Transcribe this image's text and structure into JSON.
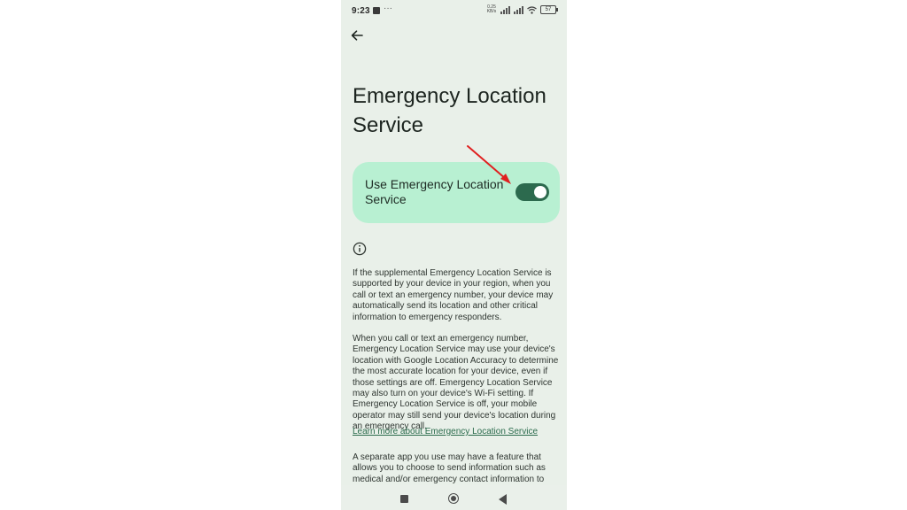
{
  "status_bar": {
    "time": "9:23",
    "net_speed": "0.25 KB/s",
    "battery": "57"
  },
  "page": {
    "title": "Emergency Location Service",
    "toggle_label": "Use Emergency Location Service",
    "toggle_on": true,
    "paragraph_1": "If the supplemental Emergency Location Service is supported by your device in your region, when you call or text an emergency number, your device may automatically send its location and other critical information to emergency responders.",
    "paragraph_2": "When you call or text an emergency number, Emergency Location Service may use your device's location with Google Location Accuracy to determine the most accurate location for your device, even if those settings are off. Emergency Location Service may also turn on your device's Wi-Fi setting. If Emergency Location Service is off, your mobile operator may still send your device's location during an emergency call.",
    "learn_more": "Learn more about Emergency Location Service",
    "paragraph_3": "A separate app you use may have a feature that allows you to choose to send information such as medical and/or emergency contact information to"
  },
  "colors": {
    "background": "#e9f0e9",
    "card": "#b8f0d2",
    "switch": "#2c6a4e",
    "link": "#2a6b4c",
    "annotation_arrow": "#e02020"
  },
  "icons": [
    "back-arrow-icon",
    "info-icon",
    "wifi-icon",
    "signal-icon",
    "battery-icon",
    "annotation-arrow-icon"
  ]
}
